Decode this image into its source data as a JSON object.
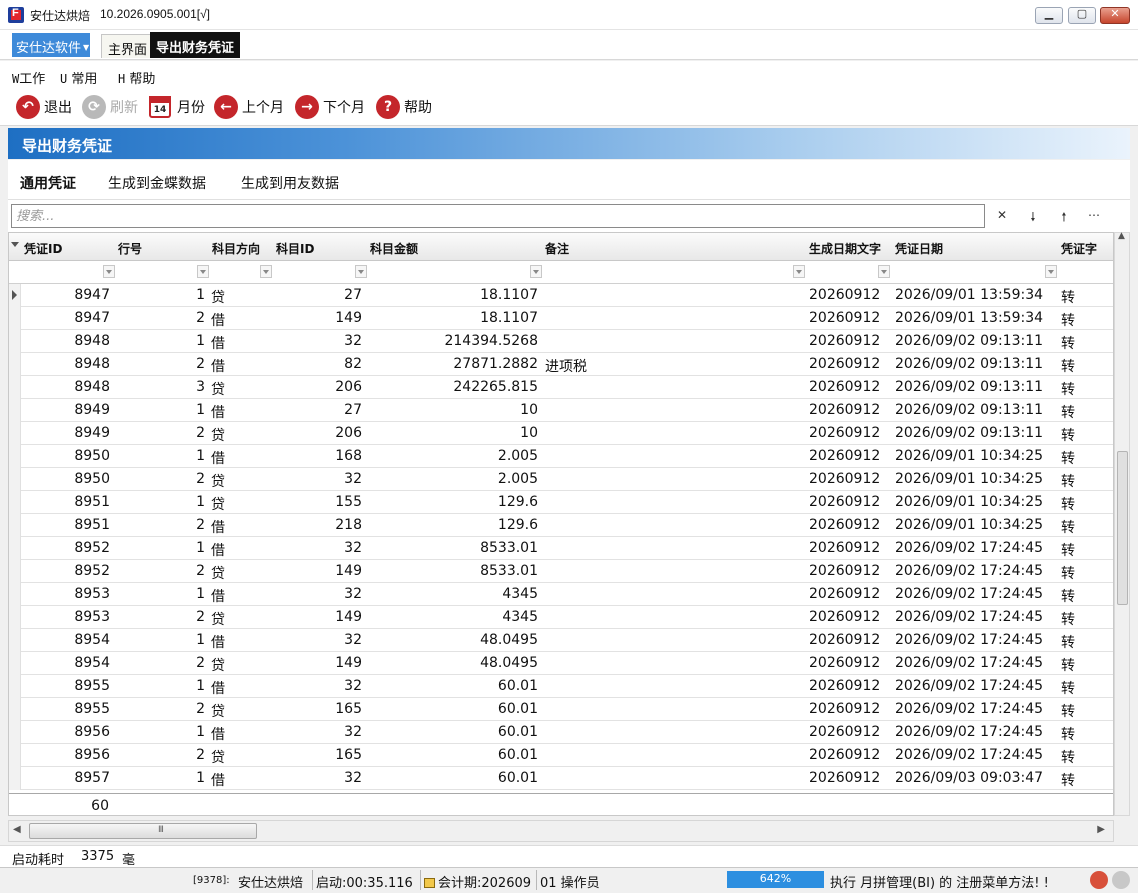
{
  "window": {
    "app_name": "安仕达烘焙",
    "version": "10.2026.0905.001[√]",
    "app_icon_letter": "F",
    "min_icon": "minimize-icon",
    "max_icon": "maximize-icon",
    "close_icon": "close-icon"
  },
  "tabs": {
    "software_menu": "安仕达软件",
    "home": "主界面",
    "active": "导出财务凭证"
  },
  "menubar": {
    "work_key": "W",
    "work": "工作",
    "common_key": "U",
    "common": "常用",
    "help_key": "H",
    "help": "帮助"
  },
  "toolbar": {
    "exit": "退出",
    "refresh": "刷新",
    "month": "月份",
    "month_icon_text": "14",
    "prev_month": "上个月",
    "next_month": "下个月",
    "help": "帮助"
  },
  "panel": {
    "title": "导出财务凭证",
    "subtabs": [
      "通用凭证",
      "生成到金蝶数据",
      "生成到用友数据"
    ]
  },
  "search": {
    "placeholder": "搜索..."
  },
  "grid": {
    "columns": [
      "凭证ID",
      "行号",
      "科目方向",
      "科目ID",
      "科目金额",
      "备注",
      "生成日期文字",
      "凭证日期",
      "凭证字"
    ],
    "rows": [
      {
        "id": "8947",
        "line": "1",
        "dir": "贷",
        "subject": "27",
        "amount": "18.1107",
        "note": "",
        "gen": "20260912",
        "date": "2026/09/01 13:59:34",
        "word": "转"
      },
      {
        "id": "8947",
        "line": "2",
        "dir": "借",
        "subject": "149",
        "amount": "18.1107",
        "note": "",
        "gen": "20260912",
        "date": "2026/09/01 13:59:34",
        "word": "转"
      },
      {
        "id": "8948",
        "line": "1",
        "dir": "借",
        "subject": "32",
        "amount": "214394.5268",
        "note": "",
        "gen": "20260912",
        "date": "2026/09/02 09:13:11",
        "word": "转"
      },
      {
        "id": "8948",
        "line": "2",
        "dir": "借",
        "subject": "82",
        "amount": "27871.2882",
        "note": "进项税",
        "gen": "20260912",
        "date": "2026/09/02 09:13:11",
        "word": "转"
      },
      {
        "id": "8948",
        "line": "3",
        "dir": "贷",
        "subject": "206",
        "amount": "242265.815",
        "note": "",
        "gen": "20260912",
        "date": "2026/09/02 09:13:11",
        "word": "转"
      },
      {
        "id": "8949",
        "line": "1",
        "dir": "借",
        "subject": "27",
        "amount": "10",
        "note": "",
        "gen": "20260912",
        "date": "2026/09/02 09:13:11",
        "word": "转"
      },
      {
        "id": "8949",
        "line": "2",
        "dir": "贷",
        "subject": "206",
        "amount": "10",
        "note": "",
        "gen": "20260912",
        "date": "2026/09/02 09:13:11",
        "word": "转"
      },
      {
        "id": "8950",
        "line": "1",
        "dir": "借",
        "subject": "168",
        "amount": "2.005",
        "note": "",
        "gen": "20260912",
        "date": "2026/09/01 10:34:25",
        "word": "转"
      },
      {
        "id": "8950",
        "line": "2",
        "dir": "贷",
        "subject": "32",
        "amount": "2.005",
        "note": "",
        "gen": "20260912",
        "date": "2026/09/01 10:34:25",
        "word": "转"
      },
      {
        "id": "8951",
        "line": "1",
        "dir": "贷",
        "subject": "155",
        "amount": "129.6",
        "note": "",
        "gen": "20260912",
        "date": "2026/09/01 10:34:25",
        "word": "转"
      },
      {
        "id": "8951",
        "line": "2",
        "dir": "借",
        "subject": "218",
        "amount": "129.6",
        "note": "",
        "gen": "20260912",
        "date": "2026/09/01 10:34:25",
        "word": "转"
      },
      {
        "id": "8952",
        "line": "1",
        "dir": "借",
        "subject": "32",
        "amount": "8533.01",
        "note": "",
        "gen": "20260912",
        "date": "2026/09/02 17:24:45",
        "word": "转"
      },
      {
        "id": "8952",
        "line": "2",
        "dir": "贷",
        "subject": "149",
        "amount": "8533.01",
        "note": "",
        "gen": "20260912",
        "date": "2026/09/02 17:24:45",
        "word": "转"
      },
      {
        "id": "8953",
        "line": "1",
        "dir": "借",
        "subject": "32",
        "amount": "4345",
        "note": "",
        "gen": "20260912",
        "date": "2026/09/02 17:24:45",
        "word": "转"
      },
      {
        "id": "8953",
        "line": "2",
        "dir": "贷",
        "subject": "149",
        "amount": "4345",
        "note": "",
        "gen": "20260912",
        "date": "2026/09/02 17:24:45",
        "word": "转"
      },
      {
        "id": "8954",
        "line": "1",
        "dir": "借",
        "subject": "32",
        "amount": "48.0495",
        "note": "",
        "gen": "20260912",
        "date": "2026/09/02 17:24:45",
        "word": "转"
      },
      {
        "id": "8954",
        "line": "2",
        "dir": "贷",
        "subject": "149",
        "amount": "48.0495",
        "note": "",
        "gen": "20260912",
        "date": "2026/09/02 17:24:45",
        "word": "转"
      },
      {
        "id": "8955",
        "line": "1",
        "dir": "借",
        "subject": "32",
        "amount": "60.01",
        "note": "",
        "gen": "20260912",
        "date": "2026/09/02 17:24:45",
        "word": "转"
      },
      {
        "id": "8955",
        "line": "2",
        "dir": "贷",
        "subject": "165",
        "amount": "60.01",
        "note": "",
        "gen": "20260912",
        "date": "2026/09/02 17:24:45",
        "word": "转"
      },
      {
        "id": "8956",
        "line": "1",
        "dir": "借",
        "subject": "32",
        "amount": "60.01",
        "note": "",
        "gen": "20260912",
        "date": "2026/09/02 17:24:45",
        "word": "转"
      },
      {
        "id": "8956",
        "line": "2",
        "dir": "贷",
        "subject": "165",
        "amount": "60.01",
        "note": "",
        "gen": "20260912",
        "date": "2026/09/02 17:24:45",
        "word": "转"
      },
      {
        "id": "8957",
        "line": "1",
        "dir": "借",
        "subject": "32",
        "amount": "60.01",
        "note": "",
        "gen": "20260912",
        "date": "2026/09/03 09:03:47",
        "word": "转"
      }
    ],
    "footer_count": "60",
    "hscroll_grip": "III"
  },
  "startup": {
    "label": "启动耗时",
    "value": "3375",
    "unit": "毫"
  },
  "statusbar": {
    "pid": "[9378]:",
    "app": "安仕达烘焙",
    "uptime": "启动:00:35.116",
    "period": "会计期:202609",
    "operator": "01 操作员",
    "progress": "642%",
    "message": "执行 月拼管理(BI) 的 注册菜单方法! !"
  }
}
